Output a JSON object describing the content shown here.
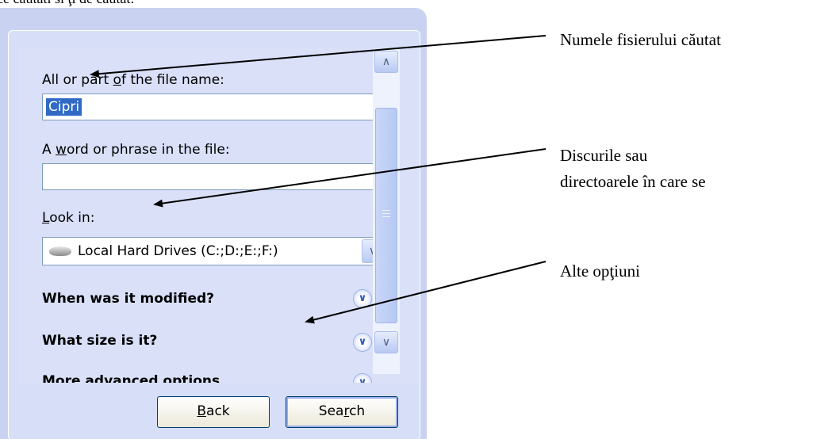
{
  "header_fragment": "ce cautati si ţi de cautat:",
  "search_pane": {
    "file_name_label_prefix": "All or part ",
    "file_name_label_accel": "o",
    "file_name_label_suffix": "f the file name:",
    "file_name_value": "Cipri",
    "word_label_prefix": "A ",
    "word_label_accel": "w",
    "word_label_suffix": "ord or phrase in the file:",
    "word_value": "",
    "look_in_label_accel": "L",
    "look_in_label_suffix": "ook in:",
    "look_in_value": "Local Hard Drives (C:;D:;E:;F:)",
    "options": [
      {
        "label": "When was it modified?"
      },
      {
        "label": "What size is it?"
      },
      {
        "label": "More advanced options"
      }
    ]
  },
  "buttons": {
    "back_accel": "B",
    "back_rest": "ack",
    "search_prefix": "Sea",
    "search_accel": "r",
    "search_suffix": "ch"
  },
  "annotations": {
    "file_name_note": "Numele fisierului căutat",
    "look_in_note_line1": "Discurile sau",
    "look_in_note_line2": "directoarele în care se",
    "options_note": "Alte opţiuni"
  },
  "colors": {
    "selection": "#316ac5",
    "panel": "#c9d3f1",
    "button_border": "#003c74"
  },
  "icons": {
    "drive": "hard-drive-icon",
    "dropdown": "chevron-down-icon",
    "expand": "double-chevron-down-icon",
    "scroll_up": "arrow-up-icon",
    "scroll_down": "arrow-down-icon"
  }
}
